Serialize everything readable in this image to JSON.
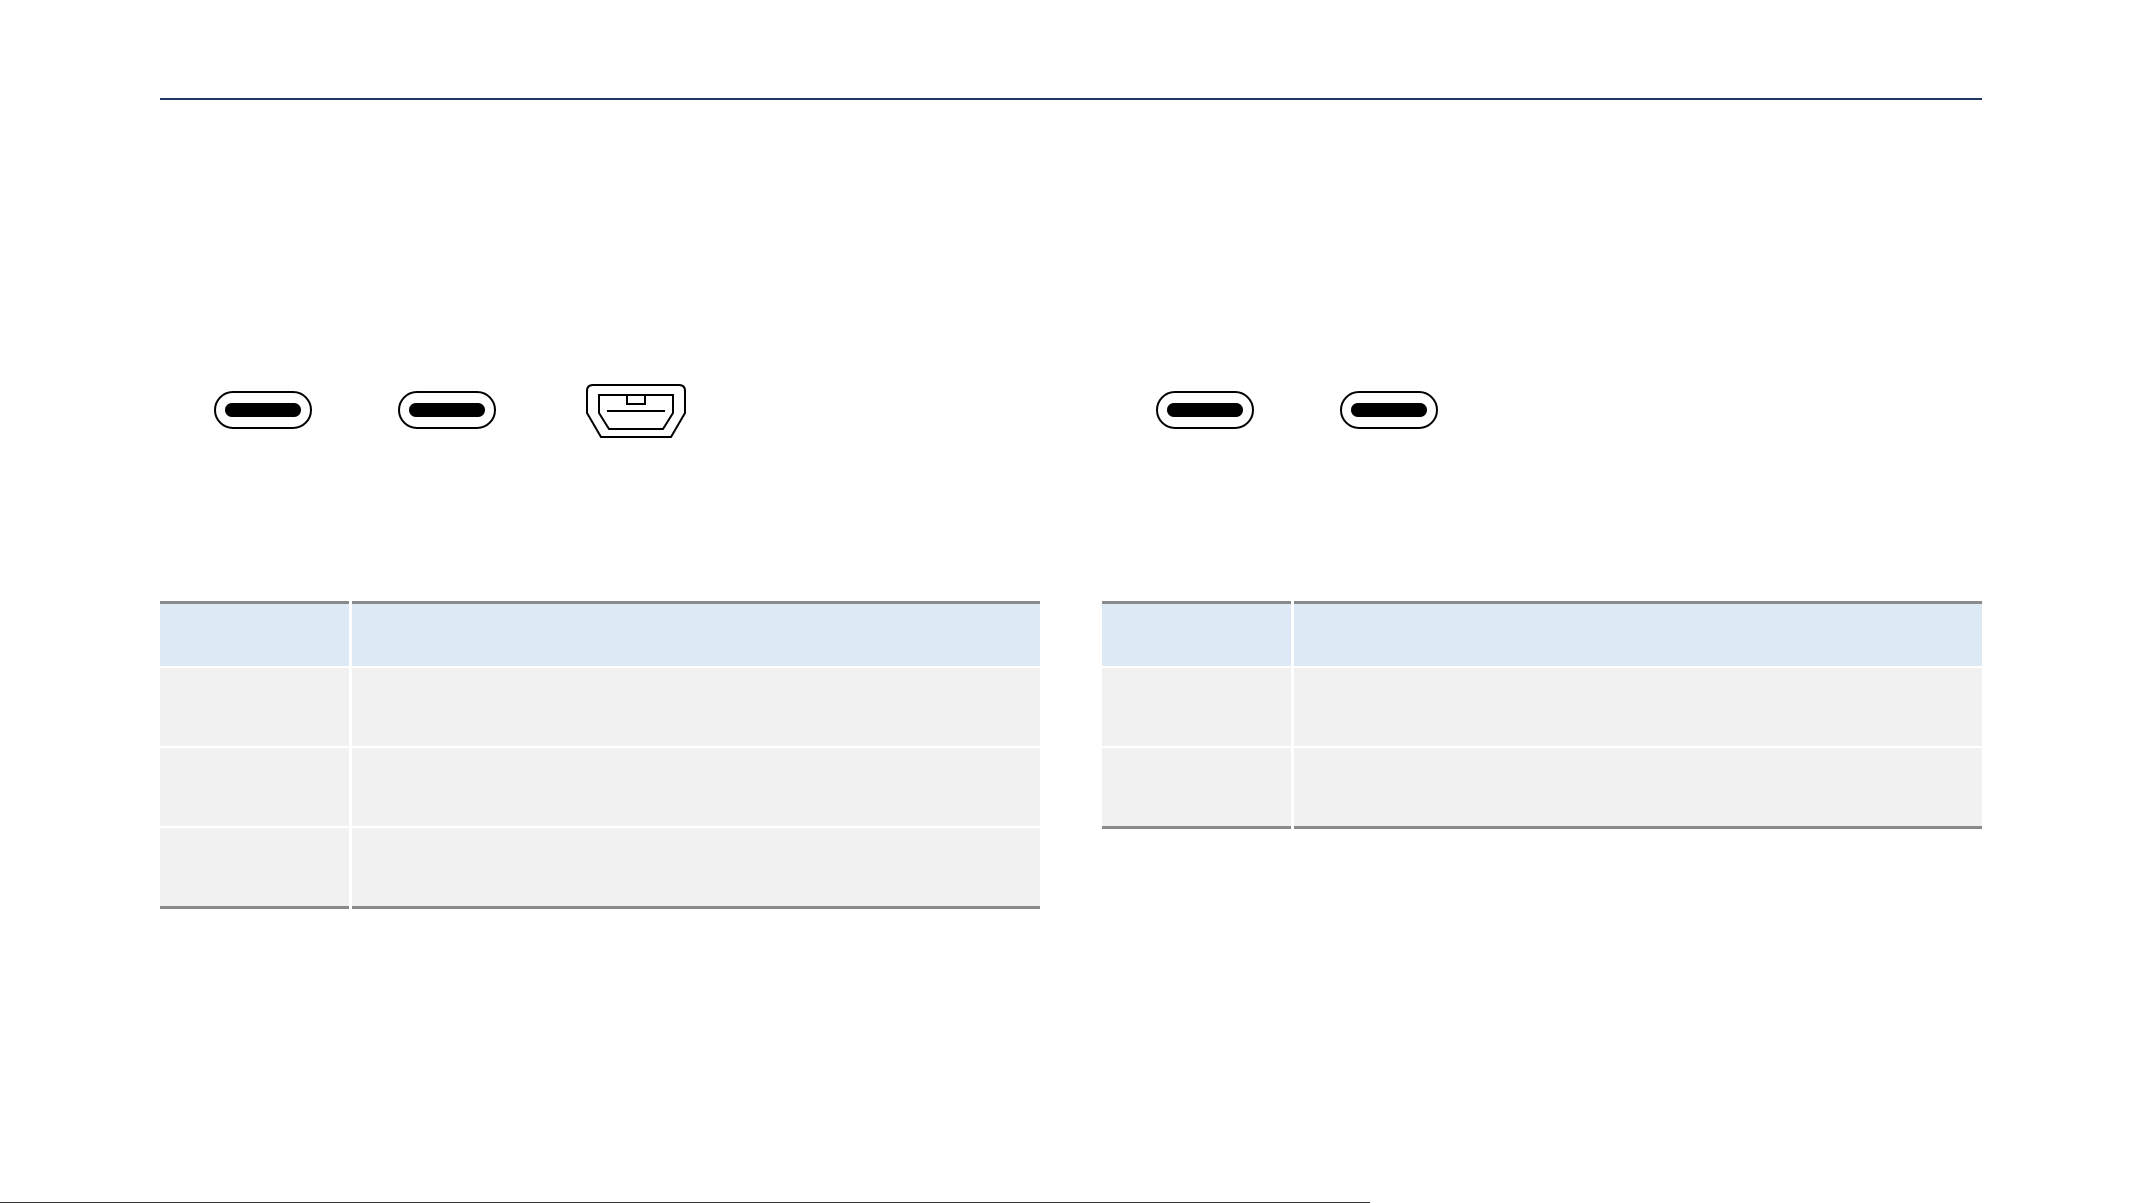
{
  "left_panel": {
    "ports": [
      {
        "icon": "usb-c-port-icon"
      },
      {
        "icon": "usb-c-port-icon"
      },
      {
        "icon": "mini-usb-port-icon"
      }
    ],
    "table": {
      "headers": [
        "",
        ""
      ],
      "rows": [
        [
          "",
          ""
        ],
        [
          "",
          ""
        ],
        [
          "",
          ""
        ]
      ]
    }
  },
  "right_panel": {
    "ports": [
      {
        "icon": "usb-c-port-icon"
      },
      {
        "icon": "usb-c-port-icon"
      }
    ],
    "table": {
      "headers": [
        "",
        ""
      ],
      "rows": [
        [
          "",
          ""
        ],
        [
          "",
          ""
        ]
      ]
    }
  },
  "colors": {
    "rule": "#1f3864",
    "table_header": "#ddeaf6",
    "table_row": "#f1f1f1",
    "table_border": "#8a8a8a"
  }
}
